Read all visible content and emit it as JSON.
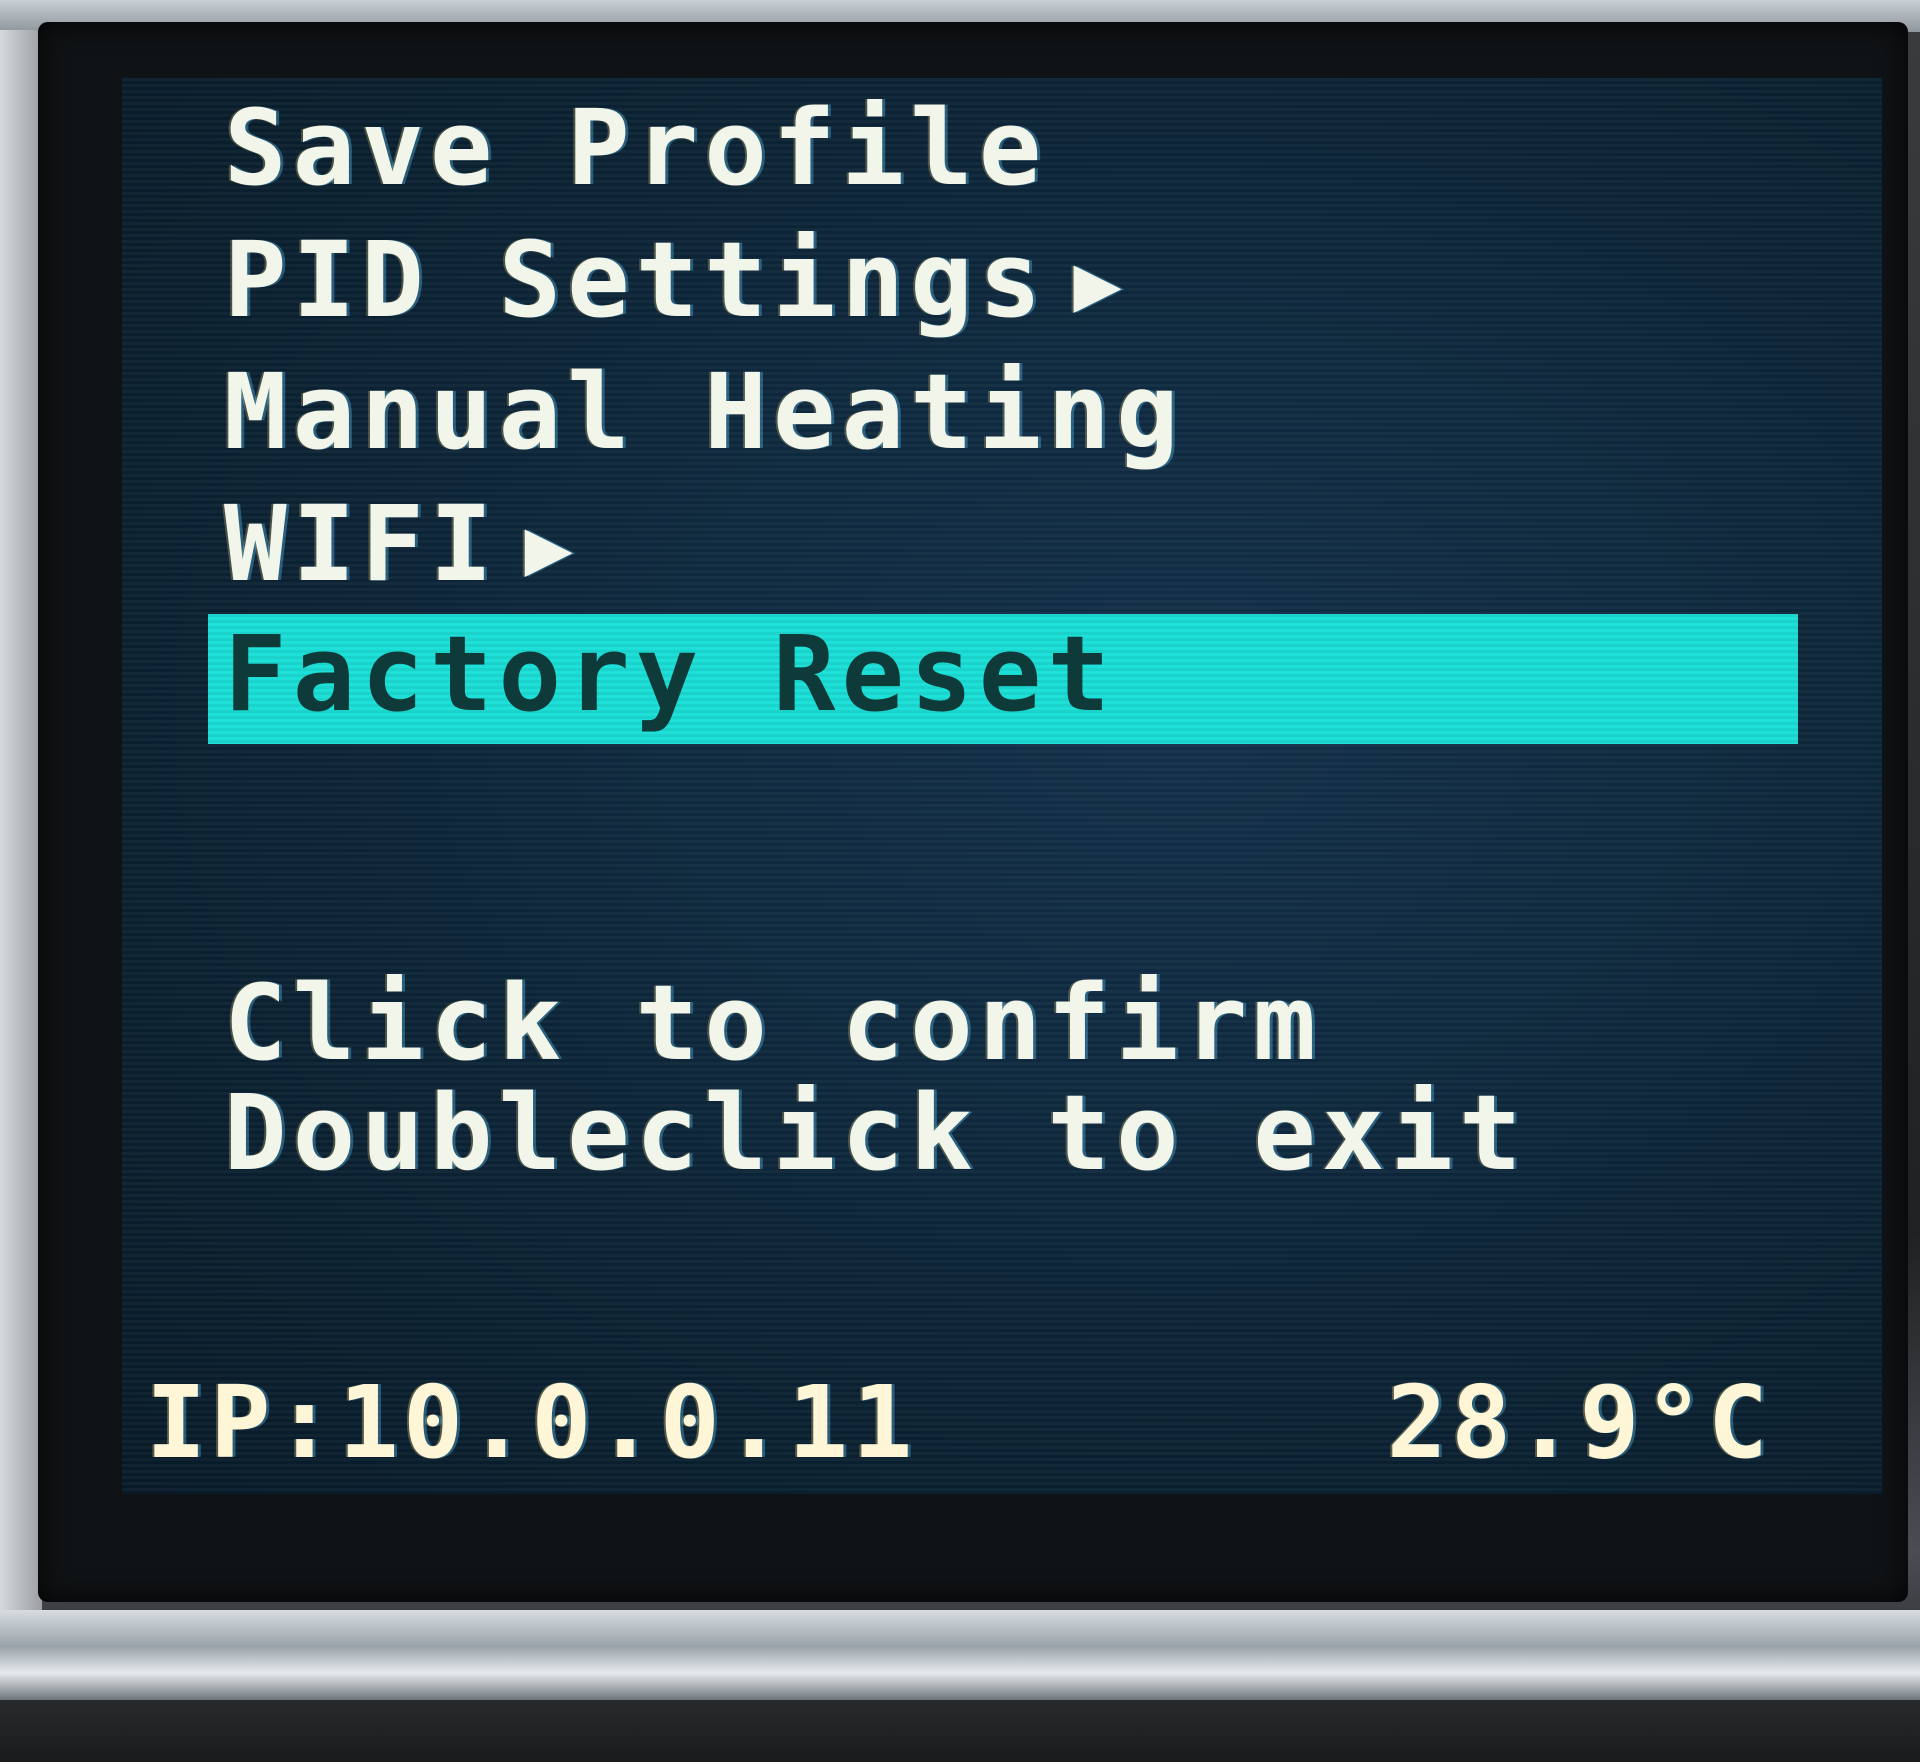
{
  "menu": {
    "items": [
      {
        "label": "Save Profile",
        "arrow": ""
      },
      {
        "label": "PID Settings",
        "arrow": "▶"
      },
      {
        "label": "Manual Heating",
        "arrow": ""
      },
      {
        "label": "WIFI",
        "arrow": "▶"
      },
      {
        "label": "Factory Reset",
        "arrow": ""
      }
    ],
    "selected_index": 4
  },
  "hints": {
    "confirm": "Click to confirm",
    "exit": "Doubleclick to exit"
  },
  "status": {
    "ip": "IP:10.0.0.11",
    "temperature": "28.9°C"
  },
  "colors": {
    "screen_bg": "#0c2538",
    "text": "#f2f6ea",
    "selection_bg": "#1de0d8",
    "selection_text": "#0e3a3a"
  }
}
